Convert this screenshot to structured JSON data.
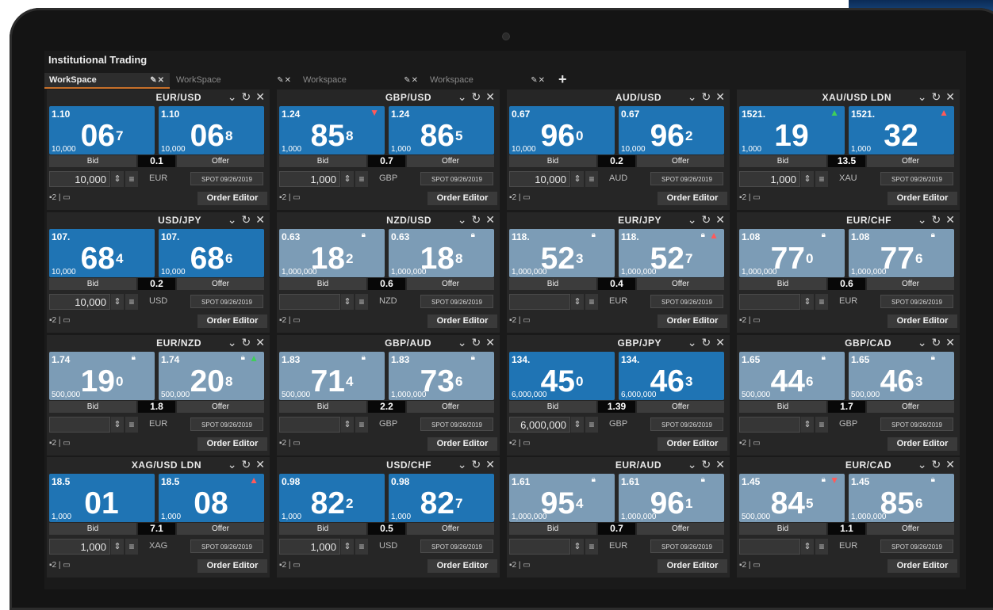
{
  "app": {
    "title": "Institutional Trading"
  },
  "tabs": [
    {
      "label": "WorkSpace",
      "icons": "✎✕",
      "active": true
    },
    {
      "label": "WorkSpace",
      "icons": "✎✕",
      "active": false
    },
    {
      "label": "Workspace",
      "icons": "✎✕",
      "active": false
    },
    {
      "label": "Workspace",
      "icons": "✎✕",
      "active": false
    }
  ],
  "add_tab": "+",
  "header_icons": "⌄ ↗ ✕",
  "labels": {
    "bid": "Bid",
    "offer": "Offer",
    "order_editor": "Order Editor",
    "spot": "SPOT 09/26/2019",
    "footer": "▪2 | ▭"
  },
  "tiles": [
    {
      "pair": "EUR/USD",
      "bid": {
        "handle": "1.10",
        "big": "06",
        "pip": "7",
        "amount": "10,000",
        "locked": false,
        "arrow": ""
      },
      "offer": {
        "handle": "1.10",
        "big": "06",
        "pip": "8",
        "amount": "10,000",
        "locked": false,
        "arrow": ""
      },
      "spread": "0.1",
      "qty": "10,000",
      "ccy": "EUR"
    },
    {
      "pair": "GBP/USD",
      "bid": {
        "handle": "1.24",
        "big": "85",
        "pip": "8",
        "amount": "1,000",
        "locked": false,
        "arrow": "down"
      },
      "offer": {
        "handle": "1.24",
        "big": "86",
        "pip": "5",
        "amount": "1,000",
        "locked": false,
        "arrow": ""
      },
      "spread": "0.7",
      "qty": "1,000",
      "ccy": "GBP"
    },
    {
      "pair": "AUD/USD",
      "bid": {
        "handle": "0.67",
        "big": "96",
        "pip": "0",
        "amount": "10,000",
        "locked": false,
        "arrow": ""
      },
      "offer": {
        "handle": "0.67",
        "big": "96",
        "pip": "2",
        "amount": "10,000",
        "locked": false,
        "arrow": ""
      },
      "spread": "0.2",
      "qty": "10,000",
      "ccy": "AUD"
    },
    {
      "pair": "XAU/USD LDN",
      "bid": {
        "handle": "1521.",
        "big": "19",
        "pip": "",
        "amount": "1,000",
        "locked": false,
        "arrow": "up"
      },
      "offer": {
        "handle": "1521.",
        "big": "32",
        "pip": "",
        "amount": "1,000",
        "locked": false,
        "arrow": "up-red"
      },
      "spread": "13.5",
      "qty": "1,000",
      "ccy": "XAU"
    },
    {
      "pair": "USD/JPY",
      "bid": {
        "handle": "107.",
        "big": "68",
        "pip": "4",
        "amount": "10,000",
        "locked": false,
        "arrow": ""
      },
      "offer": {
        "handle": "107.",
        "big": "68",
        "pip": "6",
        "amount": "10,000",
        "locked": false,
        "arrow": ""
      },
      "spread": "0.2",
      "qty": "10,000",
      "ccy": "USD"
    },
    {
      "pair": "NZD/USD",
      "bid": {
        "handle": "0.63",
        "big": "18",
        "pip": "2",
        "amount": "1,000,000",
        "locked": true,
        "arrow": ""
      },
      "offer": {
        "handle": "0.63",
        "big": "18",
        "pip": "8",
        "amount": "1,000,000",
        "locked": true,
        "arrow": ""
      },
      "spread": "0.6",
      "qty": "",
      "ccy": "NZD"
    },
    {
      "pair": "EUR/JPY",
      "bid": {
        "handle": "118.",
        "big": "52",
        "pip": "3",
        "amount": "1,000,000",
        "locked": true,
        "arrow": ""
      },
      "offer": {
        "handle": "118.",
        "big": "52",
        "pip": "7",
        "amount": "1,000,000",
        "locked": true,
        "arrow": "up-red"
      },
      "spread": "0.4",
      "qty": "",
      "ccy": "EUR"
    },
    {
      "pair": "EUR/CHF",
      "bid": {
        "handle": "1.08",
        "big": "77",
        "pip": "0",
        "amount": "1,000,000",
        "locked": true,
        "arrow": ""
      },
      "offer": {
        "handle": "1.08",
        "big": "77",
        "pip": "6",
        "amount": "1,000,000",
        "locked": true,
        "arrow": ""
      },
      "spread": "0.6",
      "qty": "",
      "ccy": "EUR"
    },
    {
      "pair": "EUR/NZD",
      "bid": {
        "handle": "1.74",
        "big": "19",
        "pip": "0",
        "amount": "500,000",
        "locked": true,
        "arrow": ""
      },
      "offer": {
        "handle": "1.74",
        "big": "20",
        "pip": "8",
        "amount": "500,000",
        "locked": true,
        "arrow": "up"
      },
      "spread": "1.8",
      "qty": "",
      "ccy": "EUR"
    },
    {
      "pair": "GBP/AUD",
      "bid": {
        "handle": "1.83",
        "big": "71",
        "pip": "4",
        "amount": "500,000",
        "locked": true,
        "arrow": ""
      },
      "offer": {
        "handle": "1.83",
        "big": "73",
        "pip": "6",
        "amount": "1,000,000",
        "locked": true,
        "arrow": ""
      },
      "spread": "2.2",
      "qty": "",
      "ccy": "GBP"
    },
    {
      "pair": "GBP/JPY",
      "bid": {
        "handle": "134.",
        "big": "45",
        "pip": "0",
        "amount": "6,000,000",
        "locked": false,
        "arrow": ""
      },
      "offer": {
        "handle": "134.",
        "big": "46",
        "pip": "3",
        "amount": "6,000,000",
        "locked": false,
        "arrow": ""
      },
      "spread": "1.39",
      "qty": "6,000,000",
      "ccy": "GBP"
    },
    {
      "pair": "GBP/CAD",
      "bid": {
        "handle": "1.65",
        "big": "44",
        "pip": "6",
        "amount": "500,000",
        "locked": true,
        "arrow": ""
      },
      "offer": {
        "handle": "1.65",
        "big": "46",
        "pip": "3",
        "amount": "500,000",
        "locked": true,
        "arrow": ""
      },
      "spread": "1.7",
      "qty": "",
      "ccy": "GBP"
    },
    {
      "pair": "XAG/USD LDN",
      "bid": {
        "handle": "18.5",
        "big": "01",
        "pip": "",
        "amount": "1,000",
        "locked": false,
        "arrow": ""
      },
      "offer": {
        "handle": "18.5",
        "big": "08",
        "pip": "",
        "amount": "1,000",
        "locked": false,
        "arrow": "up-red"
      },
      "spread": "7.1",
      "qty": "1,000",
      "ccy": "XAG"
    },
    {
      "pair": "USD/CHF",
      "bid": {
        "handle": "0.98",
        "big": "82",
        "pip": "2",
        "amount": "1,000",
        "locked": false,
        "arrow": ""
      },
      "offer": {
        "handle": "0.98",
        "big": "82",
        "pip": "7",
        "amount": "1,000",
        "locked": false,
        "arrow": ""
      },
      "spread": "0.5",
      "qty": "1,000",
      "ccy": "USD"
    },
    {
      "pair": "EUR/AUD",
      "bid": {
        "handle": "1.61",
        "big": "95",
        "pip": "4",
        "amount": "1,000,000",
        "locked": true,
        "arrow": ""
      },
      "offer": {
        "handle": "1.61",
        "big": "96",
        "pip": "1",
        "amount": "1,000,000",
        "locked": true,
        "arrow": ""
      },
      "spread": "0.7",
      "qty": "",
      "ccy": "EUR"
    },
    {
      "pair": "EUR/CAD",
      "bid": {
        "handle": "1.45",
        "big": "84",
        "pip": "5",
        "amount": "500,000",
        "locked": true,
        "arrow": "down"
      },
      "offer": {
        "handle": "1.45",
        "big": "85",
        "pip": "6",
        "amount": "1,000,000",
        "locked": true,
        "arrow": ""
      },
      "spread": "1.1",
      "qty": "",
      "ccy": "EUR"
    }
  ]
}
